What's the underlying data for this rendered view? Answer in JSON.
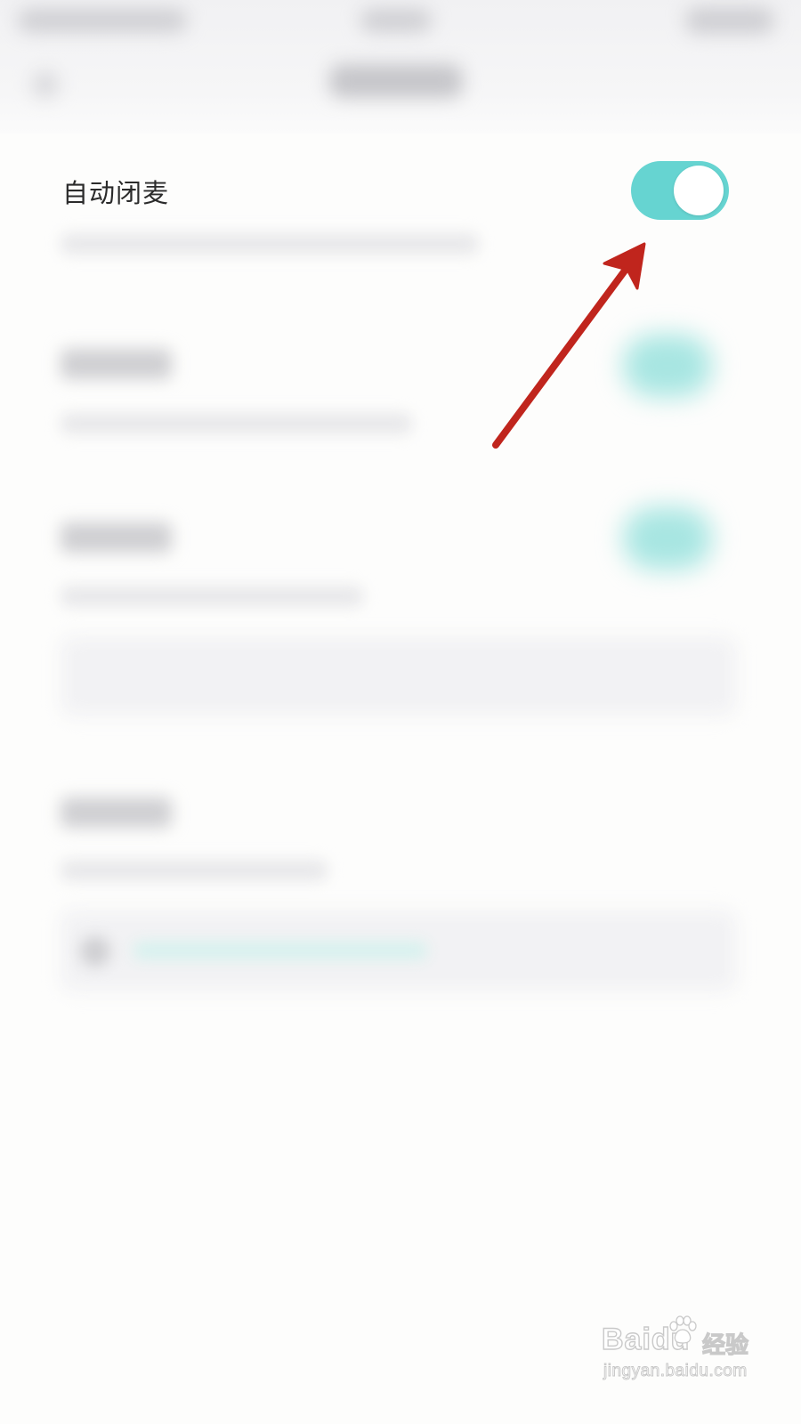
{
  "settings": {
    "auto_mute": {
      "label": "自动闭麦",
      "enabled": true
    }
  },
  "colors": {
    "toggle_on": "#66d4d1",
    "arrow": "#c0251d"
  },
  "watermark": {
    "logo": "Baidu",
    "label_cn": "经验",
    "url": "jingyan.baidu.com"
  }
}
